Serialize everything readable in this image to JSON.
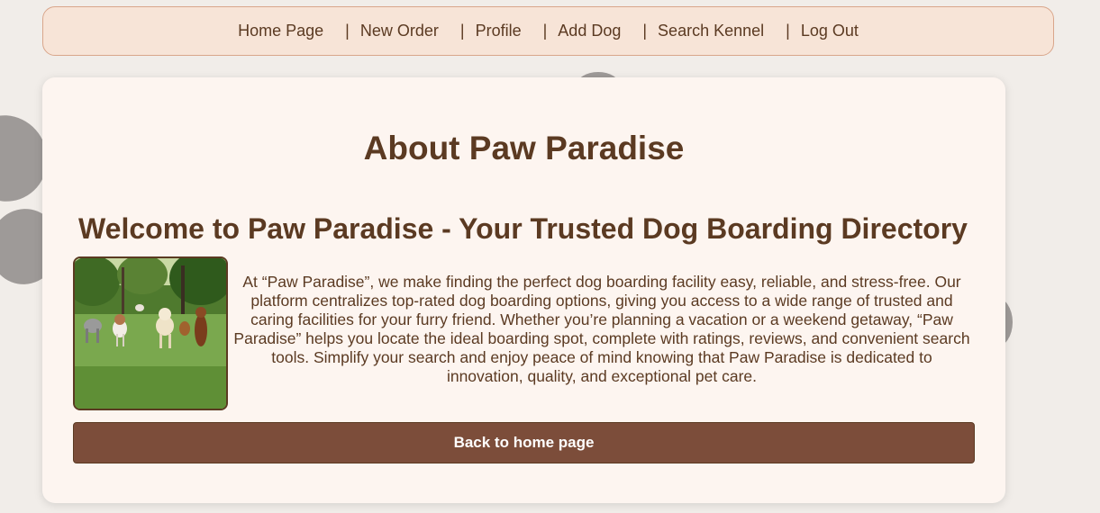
{
  "nav": {
    "items": [
      {
        "label": "Home Page"
      },
      {
        "label": "New Order"
      },
      {
        "label": "Profile"
      },
      {
        "label": "Add Dog"
      },
      {
        "label": "Search Kennel"
      },
      {
        "label": "Log Out"
      }
    ],
    "separator": "|"
  },
  "main": {
    "title": "About Paw Paradise",
    "subtitle": "Welcome to Paw Paradise - Your Trusted Dog Boarding Directory",
    "body": "At “Paw Paradise”, we make finding the perfect dog boarding facility easy, reliable, and stress-free. Our platform centralizes top-rated dog boarding options, giving you access to a wide range of trusted and caring facilities for your furry friend. Whether you’re planning a vacation or a weekend getaway, “Paw Paradise” helps you locate the ideal boarding spot, complete with ratings, reviews, and convenient search tools. Simplify your search and enjoy peace of mind knowing that Paw Paradise is dedicated to innovation, quality, and exceptional pet care.",
    "back_button": "Back to home page"
  },
  "colors": {
    "brand_brown": "#5b3a22",
    "button_brown": "#7c4d3a",
    "nav_background": "#f7e4d7",
    "card_background": "#fdf5f0",
    "page_background": "#f1ede9"
  }
}
